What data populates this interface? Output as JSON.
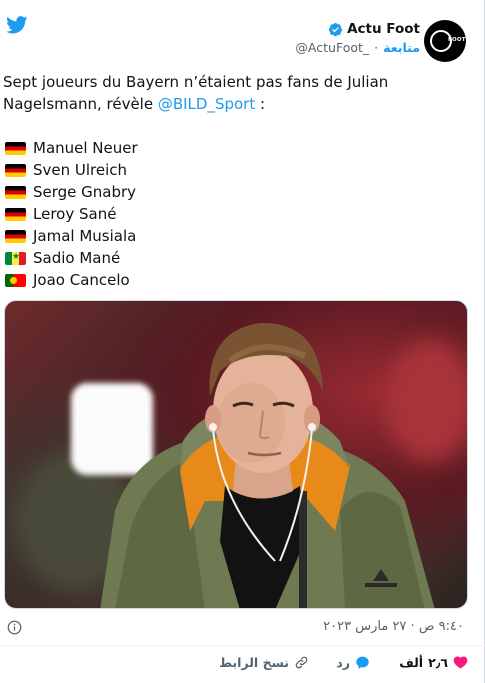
{
  "author": {
    "display_name": "Actu Foot",
    "handle": "@ActuFoot_",
    "separator": "·",
    "follow_label": "متابعة",
    "avatar_text": "FOOT"
  },
  "tweet": {
    "text_prefix": "Sept joueurs du Bayern n’étaient pas fans de Julian Nagelsmann, révèle ",
    "mention": "@BILD_Sport",
    "text_suffix": " :",
    "players": [
      {
        "flag": "germany-flag",
        "name": "Manuel Neuer"
      },
      {
        "flag": "germany-flag",
        "name": "Sven Ulreich"
      },
      {
        "flag": "germany-flag",
        "name": "Serge Gnabry"
      },
      {
        "flag": "germany-flag",
        "name": "Leroy Sané"
      },
      {
        "flag": "germany-flag",
        "name": "Jamal Musiala"
      },
      {
        "flag": "senegal-flag",
        "name": "Sadio Mané"
      },
      {
        "flag": "portugal-flag",
        "name": "Joao Cancelo"
      }
    ]
  },
  "meta": {
    "timestamp": "٩:٤٠ ص · ٢٧ مارس ٢٠٢٣"
  },
  "actions": {
    "like_count": "٢٫٦",
    "like_label": "ألف",
    "reply_label": "رد",
    "copy_link_label": "نسخ الرابط"
  },
  "colors": {
    "accent": "#1d9bf0",
    "like": "#f91880",
    "text": "#0f1419",
    "muted": "#536471"
  },
  "icons": [
    "twitter-bird-icon",
    "verified-badge-icon",
    "info-icon",
    "heart-icon",
    "reply-bubble-icon",
    "link-icon"
  ]
}
